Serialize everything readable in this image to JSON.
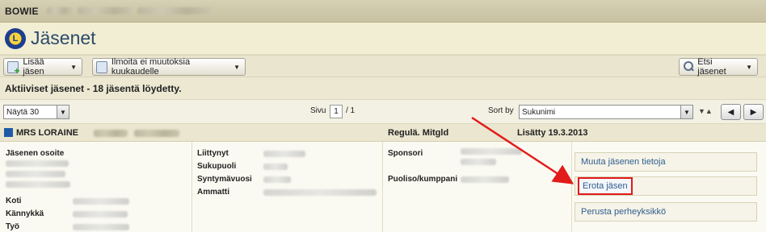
{
  "header": {
    "org_name": "BOWIE",
    "title": "Jäsenet"
  },
  "toolbar": {
    "add_member_label": "Lisää jäsen",
    "report_no_changes_label": "Ilmoita ei muutoksia kuukaudelle",
    "find_members_label": "Etsi jäsenet"
  },
  "summary": {
    "text": "Aktiiviset jäsenet - 18 jäsentä löydetty."
  },
  "pager": {
    "show_label": "Näytä 30",
    "page_label": "Sivu",
    "page_value": "1",
    "page_total": "/ 1",
    "sort_label": "Sort by",
    "sort_value": "Sukunimi",
    "prev_label": "◀",
    "next_label": "▶",
    "sort_arrows": "▼▲"
  },
  "member": {
    "name": "MRS  LORAINE",
    "status": "Regulä. Mitgld",
    "added": "Lisätty 19.3.2013",
    "fields": {
      "address_label": "Jäsenen osoite",
      "home_label": "Koti",
      "mobile_label": "Kännykkä",
      "work_label": "Työ",
      "joined_label": "Liittynyt",
      "gender_label": "Sukupuoli",
      "birth_year_label": "Syntymävuosi",
      "profession_label": "Ammatti",
      "sponsor_label": "Sponsori",
      "spouse_label": "Puoliso/kumppani"
    },
    "actions": {
      "edit": "Muuta jäsenen tietoja",
      "remove": "Erota jäsen",
      "family": "Perusta perheyksikkö"
    }
  },
  "colors": {
    "highlight": "#e21b1b",
    "link": "#2f5d8f",
    "accent": "#1f5aa6"
  }
}
